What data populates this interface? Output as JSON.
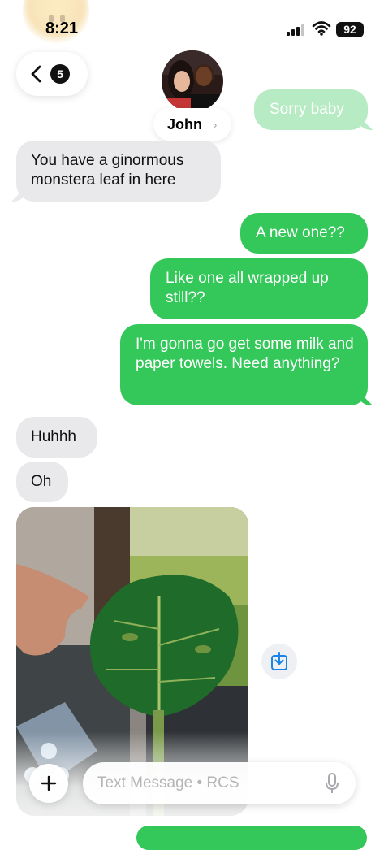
{
  "status_bar": {
    "time": "8:21",
    "battery": "92"
  },
  "header": {
    "back_badge_count": "5",
    "contact_name": "John",
    "name_chevron": "›"
  },
  "messages": {
    "m0": "Sorry baby",
    "m1": "You have a ginormous monstera leaf in here",
    "m2": "A new one??",
    "m3": "Like one all wrapped up still??",
    "m4": "I'm gonna go get some milk and paper towels. Need anything?",
    "m5": "Huhhh",
    "m6": "Oh"
  },
  "compose": {
    "placeholder": "Text Message • RCS"
  },
  "colors": {
    "sent_bubble": "#34c759",
    "received_bubble": "#e9e9eb",
    "save_icon": "#1a84e8"
  },
  "icons": {
    "back": "chevron-left-icon",
    "save": "download-tray-icon",
    "plus": "plus-icon",
    "mic": "microphone-icon",
    "wifi": "wifi-icon",
    "signal": "cellular-signal-icon"
  }
}
